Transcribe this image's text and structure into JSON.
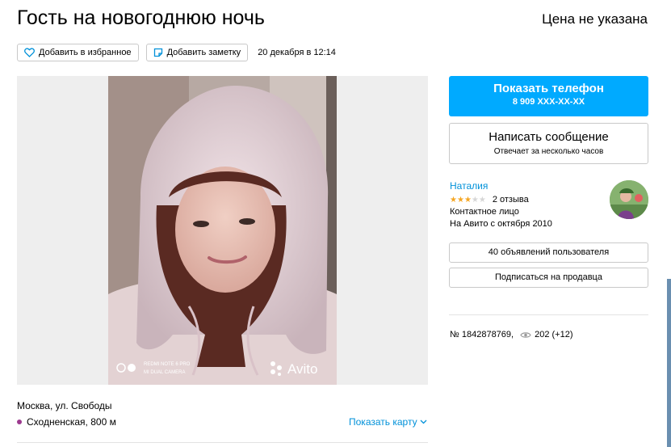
{
  "listing": {
    "title": "Гость на новогоднюю ночь",
    "price": "Цена не указана",
    "favorite_label": "Добавить в избранное",
    "note_label": "Добавить заметку",
    "date": "20 декабря в 12:14"
  },
  "photo": {
    "watermark": "Avito",
    "camera_line1": "REDMI NOTE 6 PRO",
    "camera_line2": "MI DUAL CAMERA"
  },
  "contact": {
    "phone_button": "Показать телефон",
    "phone_masked": "8 909 XXX-XX-XX",
    "message_button": "Написать сообщение",
    "message_sub": "Отвечает за несколько часов"
  },
  "seller": {
    "name": "Наталия",
    "rating_stars": 3,
    "rating_max": 5,
    "reviews": "2 отзыва",
    "role": "Контактное лицо",
    "since": "На Авито с октября 2010",
    "ads_button": "40 объявлений пользователя",
    "subscribe_button": "Подписаться на продавца"
  },
  "meta": {
    "id": "№ 1842878769,",
    "views": "202 (+12)"
  },
  "location": {
    "address": "Москва, ул. Свободы",
    "metro": "Сходненская, 800 м",
    "metro_color": "#9c3a8f",
    "map_link": "Показать карту"
  },
  "colors": {
    "accent": "#00aaff",
    "link": "#0091d9",
    "star": "#f5a623"
  }
}
